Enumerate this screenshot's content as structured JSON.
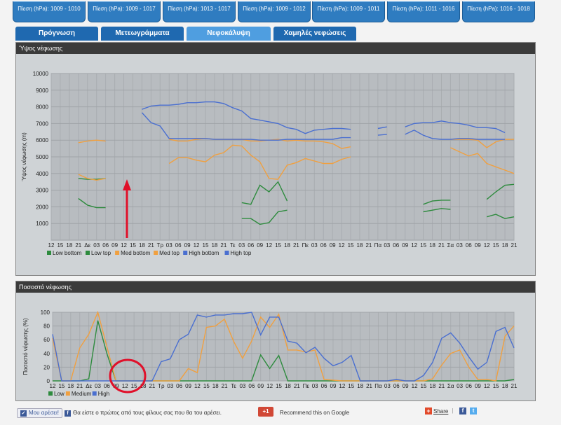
{
  "pressure_tabs": [
    "Πίεση (hPa): 1009 - 1010",
    "Πίεση (hPa): 1009 - 1017",
    "Πίεση (hPa): 1013 - 1017",
    "Πίεση (hPa): 1009 - 1012",
    "Πίεση (hPa): 1009 - 1011",
    "Πίεση (hPa): 1011 - 1016",
    "Πίεση (hPa): 1016 - 1018"
  ],
  "tabs": [
    {
      "label": "Πρόγνωση",
      "active": false
    },
    {
      "label": "Μετεωγράμματα",
      "active": false
    },
    {
      "label": "Νεφοκάλυψη",
      "active": true
    },
    {
      "label": "Χαμηλές νεφώσεις",
      "active": false
    }
  ],
  "x_ticks": [
    "12",
    "15",
    "18",
    "21",
    "Δε",
    "03",
    "06",
    "09",
    "12",
    "15",
    "18",
    "21",
    "Τρ",
    "03",
    "06",
    "09",
    "12",
    "15",
    "18",
    "21",
    "Τε",
    "03",
    "06",
    "09",
    "12",
    "15",
    "18",
    "21",
    "Πε",
    "03",
    "06",
    "09",
    "12",
    "15",
    "18",
    "21",
    "Πα",
    "03",
    "06",
    "09",
    "12",
    "15",
    "18",
    "21",
    "Σα",
    "03",
    "06",
    "09",
    "12",
    "15",
    "18",
    "21"
  ],
  "chart_data": [
    {
      "type": "line",
      "title": "Ύψος νέφωσης",
      "ylabel": "Ύψος νέφωσης (m)",
      "ylim": [
        0,
        10000
      ],
      "yticks": [
        1000,
        2000,
        3000,
        4000,
        5000,
        6000,
        7000,
        8000,
        9000,
        10000
      ],
      "grid": true,
      "legend_position": "bottom-left",
      "series": [
        {
          "name": "Low bottom",
          "color": "#2e8b3e",
          "values": [
            null,
            null,
            null,
            2500,
            2100,
            1950,
            1950,
            null,
            null,
            null,
            null,
            null,
            null,
            null,
            null,
            null,
            null,
            null,
            null,
            null,
            null,
            1300,
            1300,
            950,
            1050,
            1700,
            1800,
            null,
            null,
            null,
            null,
            null,
            null,
            null,
            null,
            null,
            null,
            null,
            null,
            null,
            null,
            1700,
            1800,
            1900,
            1850,
            null,
            null,
            null,
            1400,
            1550,
            1300,
            1400,
            1900
          ]
        },
        {
          "name": "Low top",
          "color": "#2e8b3e",
          "values": [
            null,
            null,
            null,
            3700,
            3650,
            3650,
            3700,
            null,
            null,
            null,
            null,
            null,
            null,
            null,
            null,
            null,
            null,
            null,
            null,
            null,
            null,
            2250,
            2150,
            3300,
            2900,
            3500,
            2350,
            null,
            null,
            null,
            null,
            null,
            null,
            null,
            null,
            null,
            null,
            null,
            null,
            null,
            null,
            2150,
            2350,
            2400,
            2400,
            null,
            null,
            null,
            2450,
            2900,
            3300,
            3350,
            3350
          ]
        },
        {
          "name": "Med bottom",
          "color": "#f0a040",
          "values": [
            null,
            null,
            null,
            3950,
            3700,
            3600,
            3700,
            null,
            null,
            null,
            null,
            null,
            null,
            4600,
            4950,
            4950,
            4800,
            4700,
            5100,
            5250,
            5700,
            5650,
            5100,
            4700,
            3700,
            3650,
            4500,
            4650,
            4900,
            4750,
            4600,
            4600,
            4850,
            5000,
            null,
            null,
            null,
            null,
            null,
            null,
            null,
            null,
            null,
            null,
            5550,
            5300,
            5050,
            5200,
            4600,
            4400,
            4200,
            4000,
            3700
          ]
        },
        {
          "name": "Med top",
          "color": "#f0a040",
          "values": [
            null,
            null,
            null,
            5850,
            5950,
            6000,
            5950,
            null,
            null,
            null,
            null,
            null,
            null,
            6050,
            5950,
            5950,
            6050,
            6100,
            6050,
            6050,
            6050,
            6050,
            5950,
            5950,
            6000,
            6050,
            5950,
            6000,
            5950,
            5950,
            5900,
            5800,
            5500,
            5600,
            null,
            null,
            null,
            null,
            null,
            null,
            null,
            null,
            null,
            null,
            6050,
            6050,
            6050,
            6000,
            5550,
            5900,
            6050,
            6050,
            6050
          ]
        },
        {
          "name": "High bottom",
          "color": "#4a6fd0",
          "values": [
            null,
            null,
            null,
            null,
            null,
            null,
            null,
            null,
            null,
            null,
            7650,
            7050,
            6850,
            6100,
            6100,
            6100,
            6100,
            6100,
            6050,
            6050,
            6050,
            6050,
            6050,
            6000,
            6000,
            6000,
            6050,
            6050,
            6050,
            6050,
            6050,
            6050,
            6150,
            6150,
            null,
            null,
            6300,
            6350,
            null,
            6350,
            6600,
            6300,
            6100,
            6050,
            6050,
            6100,
            6100,
            6050,
            6050,
            6050,
            6050
          ]
        },
        {
          "name": "High top",
          "color": "#4a6fd0",
          "values": [
            null,
            null,
            null,
            null,
            null,
            null,
            null,
            null,
            null,
            null,
            7850,
            8050,
            8100,
            8100,
            8150,
            8250,
            8250,
            8300,
            8300,
            8200,
            7950,
            7750,
            7300,
            7200,
            7100,
            7000,
            6750,
            6650,
            6400,
            6600,
            6650,
            6700,
            6700,
            6650,
            null,
            null,
            6700,
            6800,
            null,
            6800,
            7000,
            7050,
            7050,
            7150,
            7050,
            7000,
            6900,
            6750,
            6750,
            6700,
            6450
          ]
        }
      ]
    },
    {
      "type": "line",
      "title": "Ποσοστό νέφωσης",
      "ylabel": "Ποσοστό νέφωσης (%)",
      "ylim": [
        0,
        100
      ],
      "yticks": [
        0,
        20,
        40,
        60,
        80,
        100
      ],
      "grid": true,
      "legend_position": "bottom-left",
      "series": [
        {
          "name": "Low",
          "color": "#2e8b3e",
          "values": [
            0,
            0,
            0,
            0,
            3,
            88,
            40,
            0,
            0,
            0,
            0,
            0,
            0,
            0,
            0,
            0,
            0,
            0,
            0,
            0,
            0,
            0,
            0,
            38,
            18,
            37,
            0,
            0,
            0,
            0,
            0,
            0,
            0,
            0,
            0,
            0,
            0,
            0,
            0,
            0,
            0,
            0,
            0,
            0,
            0,
            0,
            0,
            0,
            0,
            0,
            0,
            2,
            5
          ]
        },
        {
          "name": "Medium",
          "color": "#f0a040",
          "values": [
            62,
            0,
            0,
            48,
            68,
            100,
            50,
            0,
            0,
            0,
            0,
            0,
            0,
            0,
            0,
            18,
            12,
            78,
            80,
            90,
            58,
            33,
            58,
            93,
            78,
            97,
            45,
            45,
            42,
            45,
            2,
            1,
            0,
            0,
            0,
            0,
            0,
            0,
            0,
            0,
            0,
            0,
            3,
            23,
            40,
            45,
            20,
            2,
            2,
            0,
            65,
            80,
            85
          ]
        },
        {
          "name": "High",
          "color": "#4a6fd0",
          "values": [
            68,
            0,
            0,
            0,
            0,
            0,
            0,
            0,
            0,
            0,
            0,
            0,
            28,
            32,
            60,
            68,
            96,
            93,
            96,
            96,
            98,
            98,
            100,
            67,
            93,
            93,
            58,
            55,
            41,
            49,
            33,
            22,
            27,
            37,
            0,
            0,
            0,
            0,
            2,
            0,
            0,
            8,
            27,
            62,
            70,
            55,
            35,
            17,
            27,
            72,
            78,
            48
          ]
        }
      ]
    }
  ],
  "footer": {
    "like_label": "Μου αρέσει!",
    "like_text": "Θα είστε ο πρώτος από τους φίλους σας που θα του αρέσει.",
    "gplus_label": "+1",
    "gplus_caption": "Recommend this on Google",
    "share_label": "Share"
  }
}
